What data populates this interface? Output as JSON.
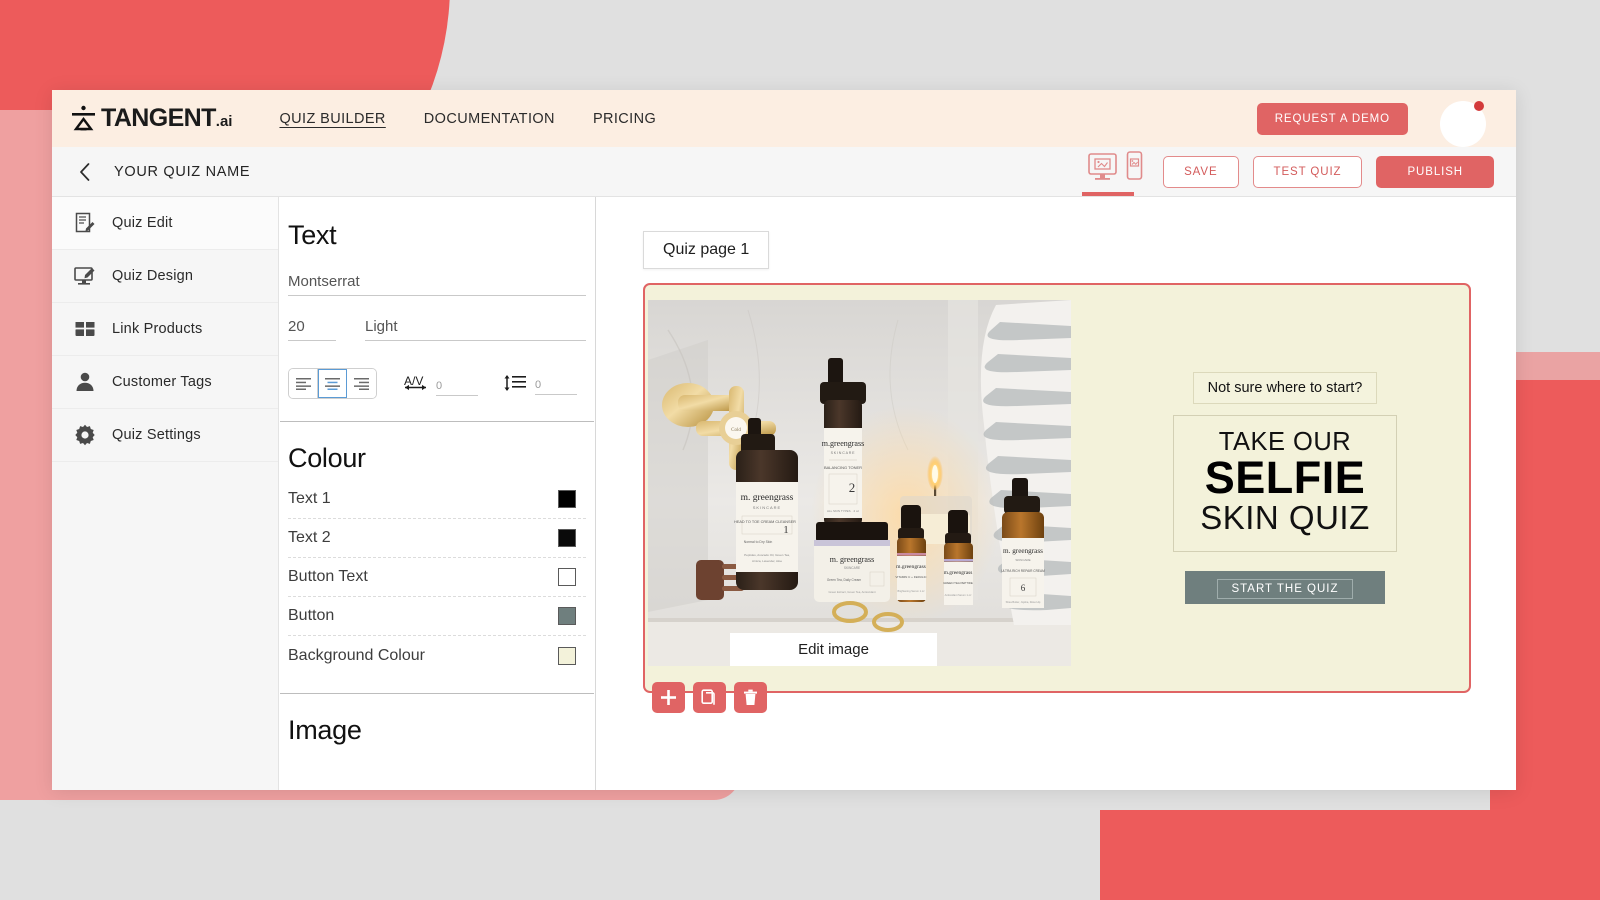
{
  "theme": {
    "accent_red": "#ed5b5b",
    "button_red": "#e06464",
    "nav_bg": "#fceee2",
    "canvas_bg": "#f3f2da",
    "page_bg": "#e0e0e0"
  },
  "top_nav": {
    "logo_text": "TANGENT",
    "logo_suffix": ".ai",
    "links": [
      {
        "label": "QUIZ BUILDER",
        "active": true
      },
      {
        "label": "DOCUMENTATION",
        "active": false
      },
      {
        "label": "PRICING",
        "active": false
      }
    ],
    "request_demo_label": "REQUEST A DEMO"
  },
  "sub_bar": {
    "quiz_name": "YOUR QUIZ NAME",
    "save_label": "SAVE",
    "test_quiz_label": "TEST QUIZ",
    "publish_label": "PUBLISH"
  },
  "sidebar": {
    "items": [
      {
        "label": "Quiz  Edit",
        "icon": "note-edit-icon",
        "active": true
      },
      {
        "label": "Quiz  Design",
        "icon": "monitor-pen-icon",
        "active": false
      },
      {
        "label": "Link Products",
        "icon": "box-icon",
        "active": false
      },
      {
        "label": "Customer Tags",
        "icon": "person-icon",
        "active": false
      },
      {
        "label": "Quiz  Settings",
        "icon": "gear-icon",
        "active": false
      }
    ]
  },
  "properties": {
    "text_section": {
      "title": "Text",
      "font_family": "Montserrat",
      "font_size": "20",
      "font_weight": "Light",
      "alignment": "center",
      "letter_spacing_value": "0",
      "line_height_value": "0"
    },
    "colour_section": {
      "title": "Colour",
      "rows": [
        {
          "label": "Text 1",
          "color": "#000000"
        },
        {
          "label": "Text 2",
          "color": "#0a0a0a"
        },
        {
          "label": "Button Text",
          "color": "#ffffff"
        },
        {
          "label": "Button",
          "color": "#6f7f7e"
        },
        {
          "label": "Background Colour",
          "color": "#f3f2da"
        }
      ]
    },
    "image_section": {
      "title": "Image"
    }
  },
  "canvas": {
    "page_tab_label": "Quiz page 1",
    "edit_image_label": "Edit image",
    "subhead": "Not sure where to start?",
    "headline_line1": "TAKE OUR",
    "headline_line2": "SELFIE",
    "headline_line3": "SKIN QUIZ",
    "start_button_label": "START THE QUIZ",
    "actions": [
      {
        "name": "add-page-button",
        "icon": "plus-icon"
      },
      {
        "name": "duplicate-page-button",
        "icon": "copy-icon"
      },
      {
        "name": "delete-page-button",
        "icon": "trash-icon"
      }
    ]
  }
}
